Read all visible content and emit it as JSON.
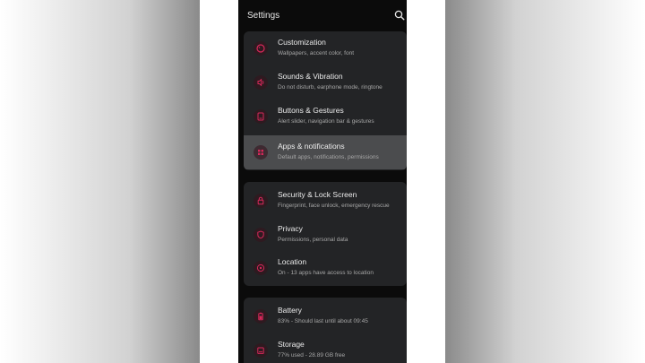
{
  "header": {
    "title": "Settings",
    "search_icon": "search-icon"
  },
  "accent": "#d7285a",
  "groups": [
    {
      "items": [
        {
          "label": "Customization",
          "sub": "Wallpapers, accent color, font",
          "icon": "palette-icon"
        },
        {
          "label": "Sounds & Vibration",
          "sub": "Do not disturb, earphone mode, ringtone",
          "icon": "sound-icon"
        },
        {
          "label": "Buttons & Gestures",
          "sub": "Alert slider, navigation bar & gestures",
          "icon": "gesture-icon"
        },
        {
          "label": "Apps & notifications",
          "sub": "Default apps, notifications, permissions",
          "icon": "apps-icon"
        }
      ]
    },
    {
      "items": [
        {
          "label": "Security & Lock Screen",
          "sub": "Fingerprint, face unlock, emergency rescue",
          "icon": "lock-icon"
        },
        {
          "label": "Privacy",
          "sub": "Permissions, personal data",
          "icon": "privacy-icon"
        },
        {
          "label": "Location",
          "sub": "On - 13 apps have access to location",
          "icon": "location-icon"
        }
      ]
    },
    {
      "items": [
        {
          "label": "Battery",
          "sub": "83% - Should last until about 09:45",
          "icon": "battery-icon"
        },
        {
          "label": "Storage",
          "sub": "77% used - 28.89 GB free",
          "icon": "storage-icon"
        }
      ]
    }
  ]
}
